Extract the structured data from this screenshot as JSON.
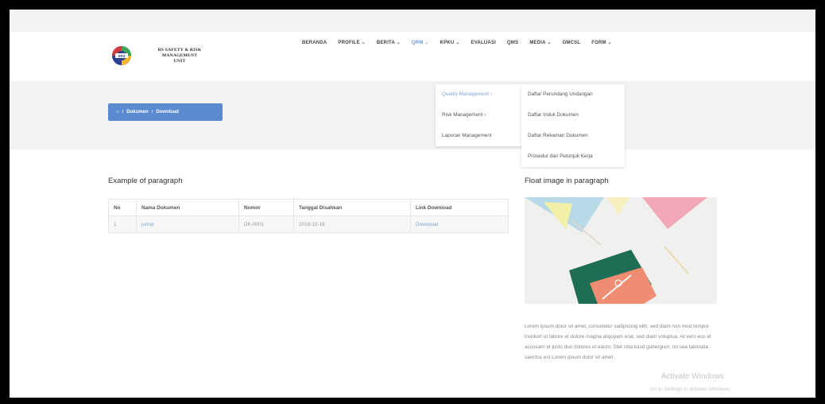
{
  "header": {
    "logo_lines": [
      "RS SAFETY & RISK",
      "MANAGEMENT",
      "UNIT"
    ],
    "nav": [
      {
        "label": "BERANDA",
        "caret": false
      },
      {
        "label": "PROFILE",
        "caret": true
      },
      {
        "label": "BERITA",
        "caret": true
      },
      {
        "label": "QRM",
        "caret": true,
        "active": true
      },
      {
        "label": "KPKU",
        "caret": true
      },
      {
        "label": "EVALUASI",
        "caret": false
      },
      {
        "label": "QMS",
        "caret": false
      },
      {
        "label": "MEDIA",
        "caret": true
      },
      {
        "label": "GMCSL",
        "caret": false
      },
      {
        "label": "FORM",
        "caret": true
      }
    ]
  },
  "breadcrumb": {
    "home_icon": "home-icon",
    "items": [
      "Dokumen",
      "Download"
    ]
  },
  "submenu": {
    "items": [
      {
        "label": "Quality Management",
        "caret": true
      },
      {
        "label": "Risk Management",
        "caret": true
      },
      {
        "label": "Laporan Management",
        "caret": false
      }
    ]
  },
  "submenu2": {
    "items": [
      "Daftar Perundang Undangan",
      "Daftar Induk Dokumen",
      "Daftar Rekaman Dokumen",
      "Prosedur dan Petunjuk Kerja"
    ]
  },
  "main": {
    "title": "Example of paragraph",
    "table": {
      "headers": [
        "No",
        "Nama Dokumen",
        "Nomor",
        "Tanggal Disahkan",
        "Link Download"
      ],
      "rows": [
        [
          "1",
          "jumat",
          "DK-0001",
          "2018-10-18",
          "Download"
        ]
      ]
    }
  },
  "side": {
    "title": "Float image in paragraph",
    "paragraph": "Lorem ipsum dolor sit amet, consetetur sadipscing elitr, sed diam non mod tempor invidunt ut labore et dolore magna aliquyam erat, sed diam voluptua. At vero eos et accusam et justo duo dolores et eaum. Stet clita kasd gubergren, no sea takimata sanctus est Lorem ipsum dolor sit amet."
  },
  "watermark": {
    "line1": "Activate Windows",
    "line2": "Go to Settings to activate Windows."
  }
}
